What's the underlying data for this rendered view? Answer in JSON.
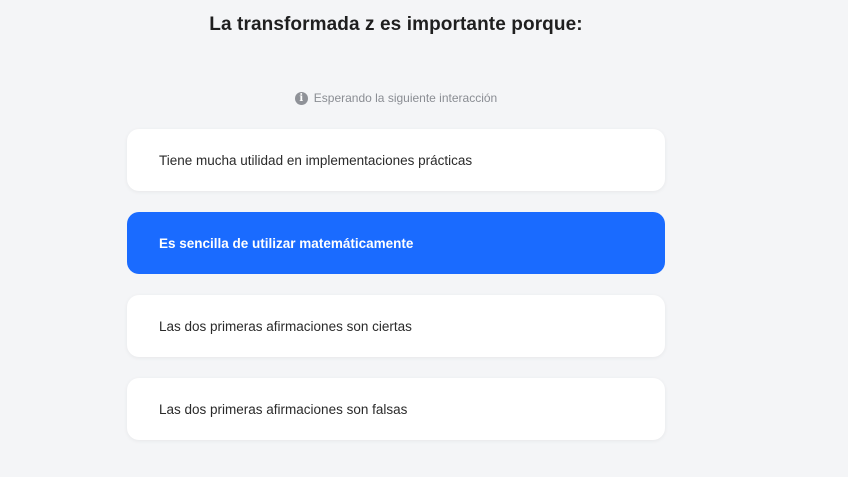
{
  "question": "La transformada z es importante porque:",
  "status": {
    "icon": "info-icon",
    "text": "Esperando la siguiente interacción"
  },
  "options": [
    {
      "label": "Tiene mucha utilidad en implementaciones prácticas",
      "selected": false
    },
    {
      "label": "Es sencilla de utilizar matemáticamente",
      "selected": true
    },
    {
      "label": "Las dos primeras afirmaciones son ciertas",
      "selected": false
    },
    {
      "label": "Las dos primeras afirmaciones son falsas",
      "selected": false
    }
  ],
  "colors": {
    "accent": "#1a6bff",
    "background": "#f4f5f7",
    "card": "#ffffff"
  }
}
